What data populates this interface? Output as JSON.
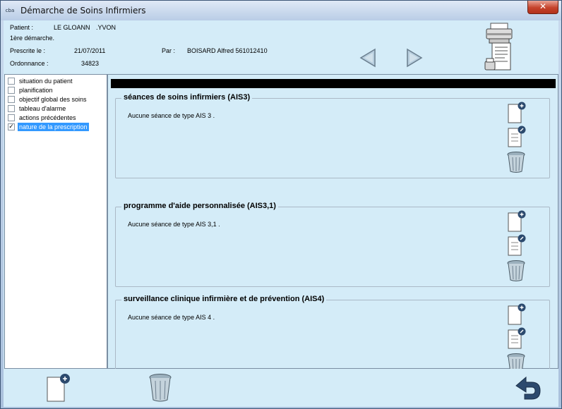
{
  "window": {
    "title": "Démarche de Soins Infirmiers",
    "app_icon_text": "cba",
    "close_label": "✕"
  },
  "header": {
    "patient_label": "Patient :",
    "patient_name": "LE GLOANN",
    "patient_firstname": ".YVON",
    "demarche": "1ère démarche.",
    "prescrite_label": "Prescrite le :",
    "prescrite_date": "21/07/2011",
    "par_label": "Par :",
    "par_value": "BOISARD Alfred 561012410",
    "ordonnance_label": "Ordonnance :",
    "ordonnance_value": "34823"
  },
  "sidebar": {
    "items": [
      {
        "label": "situation du patient",
        "checked": false
      },
      {
        "label": "planification",
        "checked": false
      },
      {
        "label": "objectif global des soins",
        "checked": false
      },
      {
        "label": "tableau d'alarme",
        "checked": false
      },
      {
        "label": "actions précédentes",
        "checked": false
      },
      {
        "label": "nature de la prescription",
        "checked": true,
        "selected": true
      }
    ],
    "check_mark": "✓"
  },
  "sections": [
    {
      "title": "séances de soins infirmiers (AIS3)",
      "text": "Aucune séance de type AIS 3 ."
    },
    {
      "title": "programme d'aide personnalisée (AIS3,1)",
      "text": "Aucune séance de type AIS 3,1 ."
    },
    {
      "title": "surveillance clinique infirmière et de prévention (AIS4)",
      "text": "Aucune séance de type AIS 4 ."
    }
  ],
  "icons": {
    "prev": "arrow-left-icon",
    "next": "arrow-right-icon",
    "print": "printer-icon",
    "add": "new-document-icon",
    "edit": "edit-document-icon",
    "delete": "trash-icon",
    "back": "return-arrow-icon"
  },
  "colors": {
    "selected": "#3399ff",
    "panel": "#d4ecf8",
    "close": "#c5432c"
  }
}
